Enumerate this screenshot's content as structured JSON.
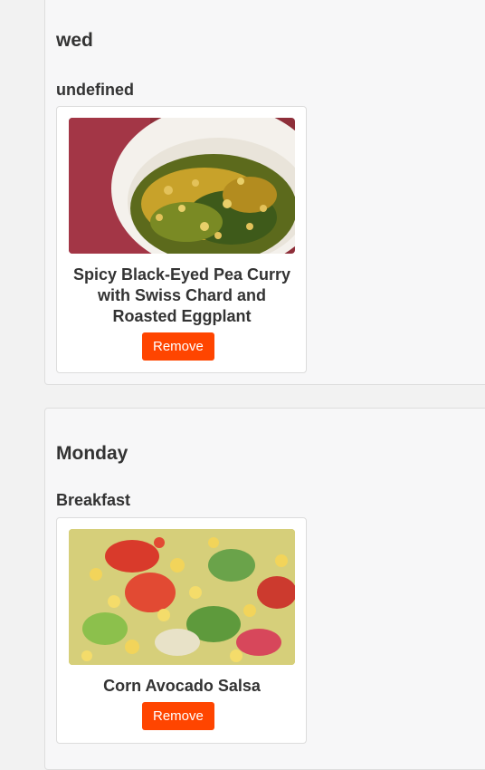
{
  "days": [
    {
      "title": "wed",
      "meal": "undefined",
      "recipe": {
        "name": "Spicy Black-Eyed Pea Curry with Swiss Chard and Roasted Eggplant",
        "remove_label": "Remove"
      }
    },
    {
      "title": "Monday",
      "meal": "Breakfast",
      "recipe": {
        "name": "Corn Avocado Salsa",
        "remove_label": "Remove"
      }
    }
  ],
  "colors": {
    "page_bg": "#f2f2f2",
    "panel_bg": "#f7f7f8",
    "card_bg": "#ffffff",
    "remove_button": "#ff4500",
    "text": "#333333"
  }
}
